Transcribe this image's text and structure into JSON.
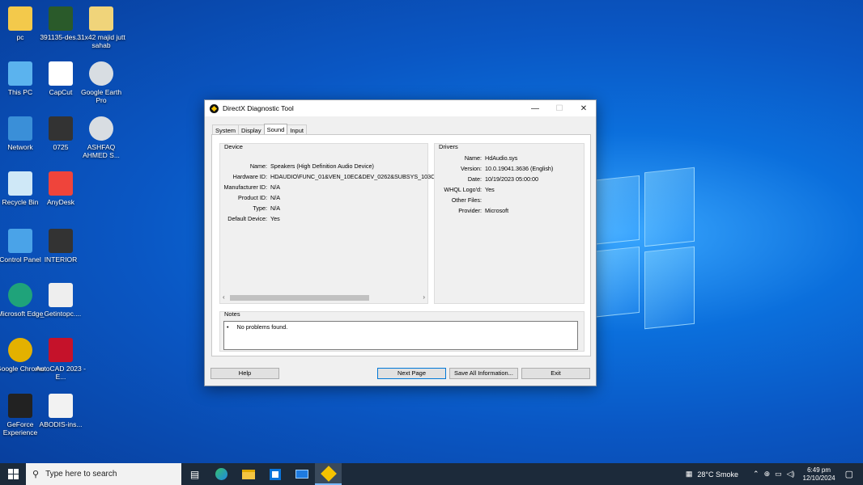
{
  "desktop": {
    "icons": [
      {
        "label": "pc",
        "icon": "folder-user-icon"
      },
      {
        "label": "391135-des...",
        "icon": "nvidia-image-icon"
      },
      {
        "label": "31x42 majid jutt sahab",
        "icon": "folder-icon"
      },
      {
        "label": "This PC",
        "icon": "this-pc-icon"
      },
      {
        "label": "CapCut",
        "icon": "capcut-icon"
      },
      {
        "label": "Google Earth Pro",
        "icon": "google-earth-icon"
      },
      {
        "label": "Network",
        "icon": "network-icon"
      },
      {
        "label": "0725",
        "icon": "image-thumbnail-icon"
      },
      {
        "label": "ASHFAQ AHMED S...",
        "icon": "google-earth-icon"
      },
      {
        "label": "Recycle Bin",
        "icon": "recycle-bin-icon"
      },
      {
        "label": "AnyDesk",
        "icon": "anydesk-icon"
      },
      {
        "label": "Control Panel",
        "icon": "control-panel-icon"
      },
      {
        "label": "INTERIOR",
        "icon": "image-thumbnail-icon"
      },
      {
        "label": "Microsoft Edge",
        "icon": "edge-icon"
      },
      {
        "label": "_Getintopc....",
        "icon": "document-icon"
      },
      {
        "label": "Google Chrome",
        "icon": "chrome-icon"
      },
      {
        "label": "AutoCAD 2023 - E...",
        "icon": "autocad-icon"
      },
      {
        "label": "GeForce Experience",
        "icon": "geforce-icon"
      },
      {
        "label": "ABODIS-ins...",
        "icon": "abodis-icon"
      }
    ]
  },
  "window": {
    "title": "DirectX Diagnostic Tool",
    "minimize": "—",
    "maximize": "☐",
    "close": "✕",
    "tabs": [
      "System",
      "Display",
      "Sound",
      "Input"
    ],
    "active_tab": "Sound",
    "device": {
      "label": "Device",
      "rows": [
        {
          "k": "Name:",
          "v": "Speakers (High Definition Audio Device)"
        },
        {
          "k": "Hardware ID:",
          "v": "HDAUDIO\\FUNC_01&VEN_10EC&DEV_0262&SUBSYS_103C"
        },
        {
          "k": "Manufacturer ID:",
          "v": "N/A"
        },
        {
          "k": "Product ID:",
          "v": "N/A"
        },
        {
          "k": "Type:",
          "v": "N/A"
        },
        {
          "k": "Default Device:",
          "v": "Yes"
        }
      ]
    },
    "drivers": {
      "label": "Drivers",
      "rows": [
        {
          "k": "Name:",
          "v": "HdAudio.sys"
        },
        {
          "k": "Version:",
          "v": "10.0.19041.3636 (English)"
        },
        {
          "k": "Date:",
          "v": "10/19/2023 05:00:00"
        },
        {
          "k": "WHQL Logo'd:",
          "v": "Yes"
        },
        {
          "k": "Other Files:",
          "v": ""
        },
        {
          "k": "Provider:",
          "v": "Microsoft"
        }
      ]
    },
    "notes": {
      "label": "Notes",
      "items": [
        "No problems found."
      ]
    },
    "buttons": {
      "help": "Help",
      "next": "Next Page",
      "save": "Save All Information...",
      "exit": "Exit"
    }
  },
  "taskbar": {
    "search_placeholder": "Type here to search",
    "weather": "28°C  Smoke",
    "time": "6:49 pm",
    "date": "12/10/2024"
  }
}
